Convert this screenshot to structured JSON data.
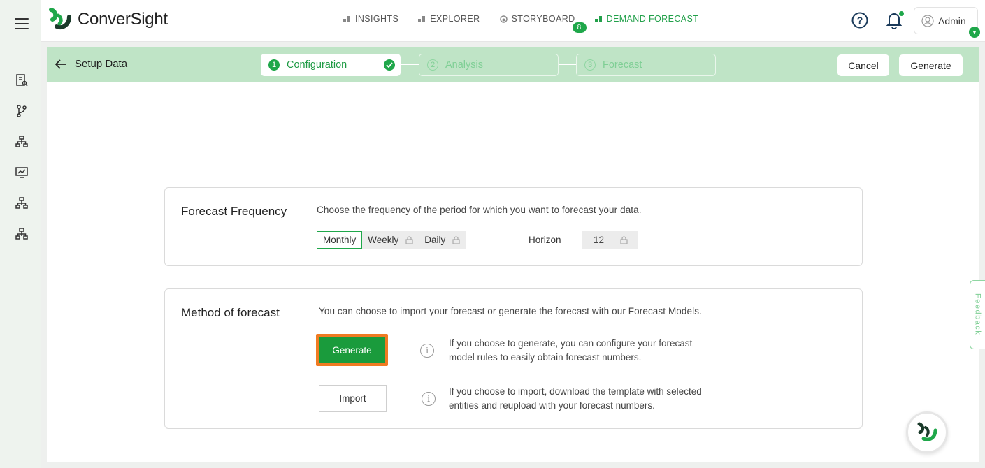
{
  "app": {
    "name": "ConverSight"
  },
  "nav": [
    {
      "label": "INSIGHTS",
      "active": false
    },
    {
      "label": "EXPLORER",
      "active": false
    },
    {
      "label": "STORYBOARD",
      "active": false,
      "badge": "8"
    },
    {
      "label": "DEMAND FORECAST",
      "active": true
    }
  ],
  "user": {
    "name": "Admin"
  },
  "stepbar": {
    "back_label": "Setup Data",
    "steps": [
      {
        "num": "1",
        "label": "Configuration",
        "state": "active"
      },
      {
        "num": "2",
        "label": "Analysis",
        "state": "inactive"
      },
      {
        "num": "3",
        "label": "Forecast",
        "state": "inactive"
      }
    ],
    "cancel_label": "Cancel",
    "generate_label": "Generate"
  },
  "frequency": {
    "title": "Forecast Frequency",
    "description": "Choose the frequency of the period for which you want to forecast your data.",
    "options": [
      {
        "label": "Monthly",
        "selected": true,
        "locked": false
      },
      {
        "label": "Weekly",
        "selected": false,
        "locked": true
      },
      {
        "label": "Daily",
        "selected": false,
        "locked": true
      }
    ],
    "horizon_label": "Horizon",
    "horizon_value": "12"
  },
  "method": {
    "title": "Method of forecast",
    "description": "You can choose to import your forecast or generate the forecast with our Forecast Models.",
    "generate_label": "Generate",
    "generate_info_line1": "If you choose to generate, you can configure your forecast",
    "generate_info_line2": "model rules to easily obtain forecast numbers.",
    "import_label": "Import",
    "import_info_line1": "If you choose to import, download the template with selected",
    "import_info_line2": "entities and reupload with your forecast numbers."
  },
  "feedback_label": "Feedback",
  "colors": {
    "brand": "#1fa74a",
    "stepbar": "#bfe4c6",
    "highlight": "#f07b22"
  }
}
